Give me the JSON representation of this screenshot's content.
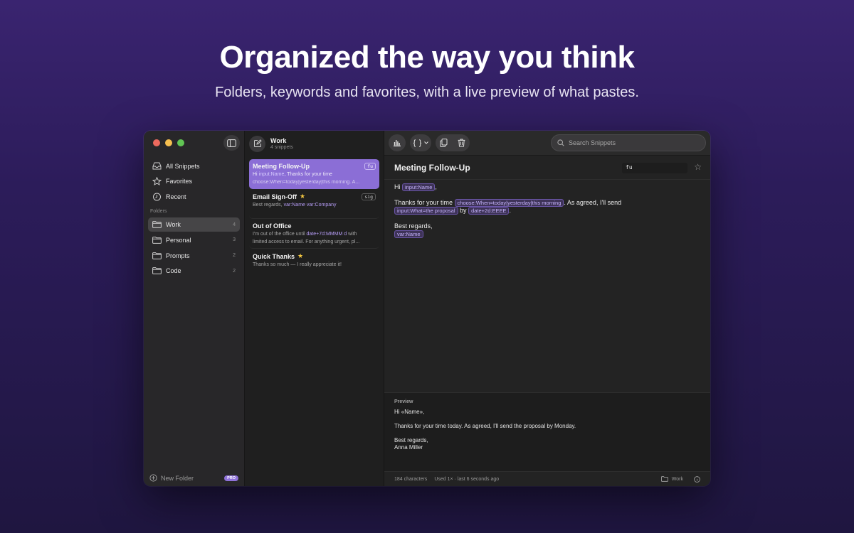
{
  "hero": {
    "title": "Organized the way you think",
    "subtitle": "Folders, keywords and favorites, with a live preview of what pastes."
  },
  "sidebar": {
    "nav": [
      {
        "label": "All Snippets",
        "icon": "tray-icon"
      },
      {
        "label": "Favorites",
        "icon": "star-icon"
      },
      {
        "label": "Recent",
        "icon": "clock-icon"
      }
    ],
    "section_label": "Folders",
    "folders": [
      {
        "label": "Work",
        "count": "4",
        "active": true
      },
      {
        "label": "Personal",
        "count": "3"
      },
      {
        "label": "Prompts",
        "count": "2"
      },
      {
        "label": "Code",
        "count": "2"
      }
    ],
    "new_folder_label": "New Folder",
    "pro_badge": "PRO"
  },
  "list": {
    "title": "Work",
    "subtitle": "4 snippets",
    "snippets": [
      {
        "title": "Meeting Follow-Up",
        "keyword": "fu",
        "line1_pre": "Hi ",
        "line1_tok": "input:Name",
        "line1_post": ", Thanks for your time",
        "line2": "choose:When=today|yesterday|this morning. A..."
      },
      {
        "title": "Email Sign-Off",
        "favorite": "★",
        "keyword": "sig",
        "line1_pre": "Best regards, ",
        "line1_tok": "var:Name var:Company"
      },
      {
        "title": "Out of Office",
        "line1_pre": "I'm out of the office until ",
        "line1_tok": "date+7d:MMMM d",
        "line1_post": " with",
        "line2": "limited access to email. For anything urgent, pl..."
      },
      {
        "title": "Quick Thanks",
        "favorite": "★",
        "line1_pre": "Thanks so much — I really appreciate it!"
      }
    ]
  },
  "editor": {
    "search_placeholder": "Search Snippets",
    "title": "Meeting Follow-Up",
    "keyword": "fu",
    "body": {
      "hi": "Hi",
      "tok_name": "input:Name",
      "comma": ",",
      "thanks": "Thanks for your time",
      "tok_choose": "choose:When=today|yesterday|this morning",
      "agreed": ". As agreed, I'll send",
      "tok_what": "input:What=the proposal",
      "by": "by",
      "tok_date": "date+2d:EEEE",
      "period": ".",
      "regards": "Best regards,",
      "tok_var": "var:Name"
    },
    "preview": {
      "label": "Preview",
      "line1": "Hi «Name»,",
      "line2": "Thanks for your time today. As agreed, I'll send the proposal by Monday.",
      "line3": "Best regards,",
      "line4": "Anna Miller"
    },
    "status": {
      "chars": "184 characters",
      "used": "Used 1× · last 6 seconds ago",
      "folder": "Work"
    }
  },
  "colors": {
    "accent": "#8b6ed6",
    "chip_bg": "#3e3358",
    "pro": "#8f72d9"
  }
}
